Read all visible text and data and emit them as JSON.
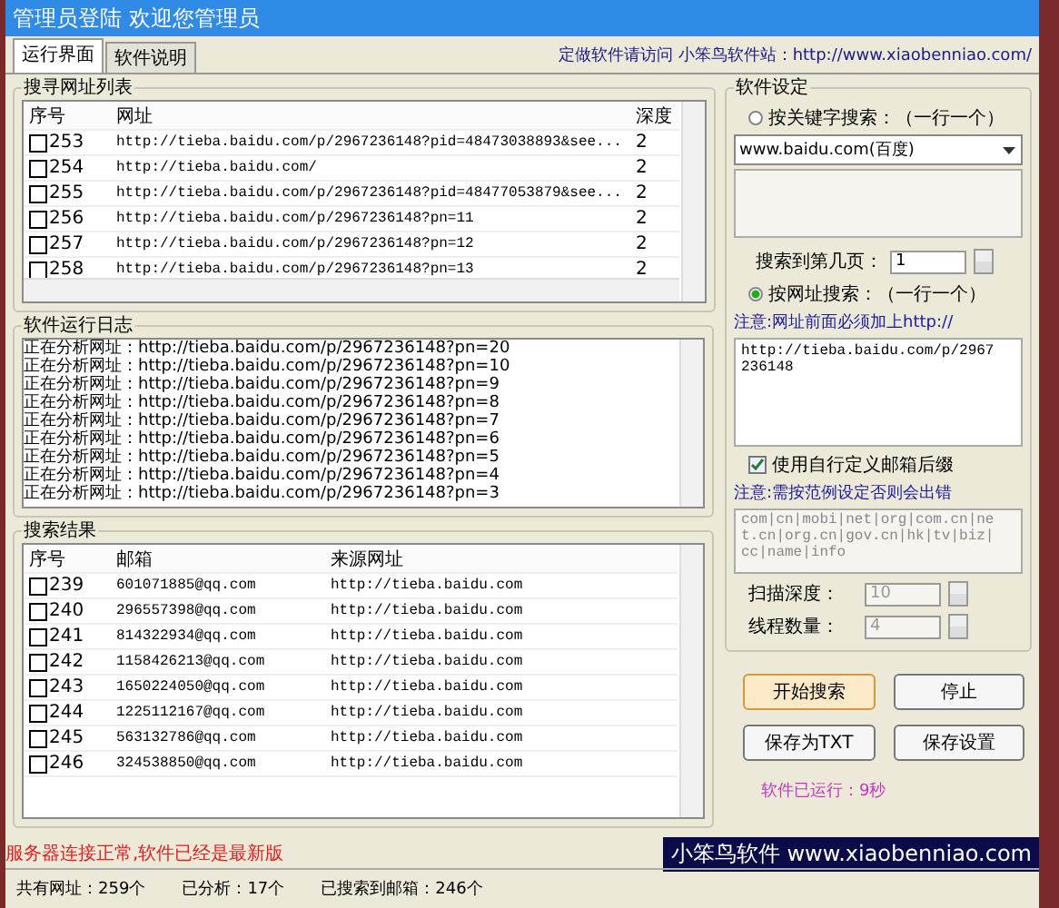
{
  "window": {
    "title": "管理员登陆 欢迎您管理员"
  },
  "tabs": [
    {
      "label": "运行界面",
      "selected": true
    },
    {
      "label": "软件说明",
      "selected": false
    }
  ],
  "header_link": "定做软件请访问 小笨鸟软件站：http://www.xiaobenniao.com/",
  "url_list": {
    "title": "搜寻网址列表",
    "columns": [
      "序号",
      "网址",
      "深度"
    ],
    "rows": [
      {
        "checked": false,
        "no": "253",
        "url": "http://tieba.baidu.com/p/2967236148?pid=48473038893&see...",
        "depth": "2"
      },
      {
        "checked": false,
        "no": "254",
        "url": "http://tieba.baidu.com/",
        "depth": "2"
      },
      {
        "checked": false,
        "no": "255",
        "url": "http://tieba.baidu.com/p/2967236148?pid=48477053879&see...",
        "depth": "2"
      },
      {
        "checked": false,
        "no": "256",
        "url": "http://tieba.baidu.com/p/2967236148?pn=11",
        "depth": "2"
      },
      {
        "checked": false,
        "no": "257",
        "url": "http://tieba.baidu.com/p/2967236148?pn=12",
        "depth": "2"
      },
      {
        "checked": false,
        "no": "258",
        "url": "http://tieba.baidu.com/p/2967236148?pn=13",
        "depth": "2"
      }
    ]
  },
  "log": {
    "title": "软件运行日志",
    "lines": [
      "正在分析网址：http://tieba.baidu.com/p/2967236148?pn=20",
      "正在分析网址：http://tieba.baidu.com/p/2967236148?pn=10",
      "正在分析网址：http://tieba.baidu.com/p/2967236148?pn=9",
      "正在分析网址：http://tieba.baidu.com/p/2967236148?pn=8",
      "正在分析网址：http://tieba.baidu.com/p/2967236148?pn=7",
      "正在分析网址：http://tieba.baidu.com/p/2967236148?pn=6",
      "正在分析网址：http://tieba.baidu.com/p/2967236148?pn=5",
      "正在分析网址：http://tieba.baidu.com/p/2967236148?pn=4",
      "正在分析网址：http://tieba.baidu.com/p/2967236148?pn=3"
    ]
  },
  "results": {
    "title": "搜索结果",
    "columns": [
      "序号",
      "邮箱",
      "来源网址"
    ],
    "rows": [
      {
        "checked": false,
        "no": "239",
        "email": "601071885@qq.com",
        "source": "http://tieba.baidu.com"
      },
      {
        "checked": false,
        "no": "240",
        "email": "296557398@qq.com",
        "source": "http://tieba.baidu.com"
      },
      {
        "checked": false,
        "no": "241",
        "email": "814322934@qq.com",
        "source": "http://tieba.baidu.com"
      },
      {
        "checked": false,
        "no": "242",
        "email": "1158426213@qq.com",
        "source": "http://tieba.baidu.com"
      },
      {
        "checked": false,
        "no": "243",
        "email": "1650224050@qq.com",
        "source": "http://tieba.baidu.com"
      },
      {
        "checked": false,
        "no": "244",
        "email": "1225112167@qq.com",
        "source": "http://tieba.baidu.com"
      },
      {
        "checked": false,
        "no": "245",
        "email": "563132786@qq.com",
        "source": "http://tieba.baidu.com"
      },
      {
        "checked": false,
        "no": "246",
        "email": "324538850@qq.com",
        "source": "http://tieba.baidu.com"
      }
    ]
  },
  "settings": {
    "title": "软件设定",
    "keyword_radio": {
      "label": "按关键字搜索：（一行一个）",
      "selected": false
    },
    "engine": "www.baidu.com(百度)",
    "pages_label": "搜索到第几页：",
    "pages": "1",
    "url_radio": {
      "label": "按网址搜索：（一行一个）",
      "selected": true
    },
    "url_note": "注意:网址前面必须加上http://",
    "urls": "http://tieba.baidu.com/p/2967236148",
    "custom_suffix": {
      "label": "使用自行定义邮箱后缀",
      "checked": true
    },
    "suffix_note": "注意:需按范例设定否则会出错",
    "suffixes": "com|cn|mobi|net|org|com.cn|net.cn|org.cn|gov.cn|hk|tv|biz|cc|name|info",
    "depth_label": "扫描深度：",
    "depth": "10",
    "threads_label": "线程数量：",
    "threads": "4"
  },
  "buttons": [
    {
      "label": "开始搜索",
      "primary": true
    },
    {
      "label": "停止",
      "primary": false
    },
    {
      "label": "保存为TXT",
      "primary": false
    },
    {
      "label": "保存设置",
      "primary": false
    }
  ],
  "runtime": "软件已运行：9秒",
  "server_status": "服务器连接正常,软件已经是最新版",
  "banner": "小笨鸟软件 www.xiaobenniao.com",
  "status_bar": [
    "共有网址：259个",
    "已分析：17个",
    "已搜索到邮箱：246个"
  ]
}
